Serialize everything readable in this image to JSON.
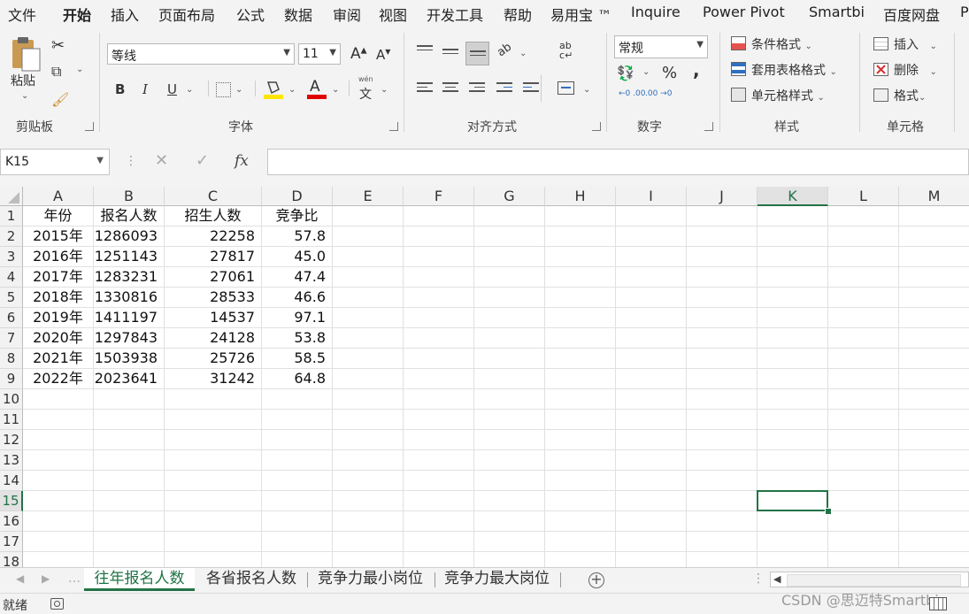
{
  "menu": [
    "文件",
    "开始",
    "插入",
    "页面布局",
    "公式",
    "数据",
    "审阅",
    "视图",
    "开发工具",
    "帮助",
    "易用宝 ™",
    "Inquire",
    "Power Pivot",
    "Smartbi",
    "百度网盘",
    "P"
  ],
  "ribbon": {
    "clipboard": {
      "paste": "粘贴",
      "group": "剪贴板"
    },
    "font": {
      "name": "等线",
      "size": "11",
      "bold": "B",
      "italic": "I",
      "underline": "U",
      "grow": "A",
      "shrink": "A",
      "color_a": "A",
      "phonetic": "文",
      "phonetic_top": "wén",
      "group": "字体"
    },
    "alignment": {
      "group": "对齐方式",
      "orient": "ab",
      "wrap_top": "ab",
      "wrap_bottom": "c"
    },
    "number": {
      "format": "常规",
      "percent": "%",
      "comma": ",",
      "inc": "←0 .00",
      "dec": ".00 →0",
      "group": "数字"
    },
    "styles": {
      "conditional": "条件格式",
      "table": "套用表格格式",
      "cell": "单元格样式",
      "group": "样式"
    },
    "cells": {
      "insert": "插入",
      "delete": "删除",
      "format": "格式",
      "group": "单元格"
    }
  },
  "formula_bar": {
    "name_box": "K15",
    "fx": "fx",
    "cancel": "✕",
    "enter": "✓",
    "content": ""
  },
  "columns": [
    "A",
    "B",
    "C",
    "D",
    "E",
    "F",
    "G",
    "H",
    "I",
    "J",
    "K",
    "L",
    "M"
  ],
  "rows": [
    "1",
    "2",
    "3",
    "4",
    "5",
    "6",
    "7",
    "8",
    "9",
    "10",
    "11",
    "12",
    "13",
    "14",
    "15",
    "16",
    "17",
    "18"
  ],
  "selected": {
    "col": "K",
    "row": "15"
  },
  "table": {
    "header": [
      "年份",
      "报名人数",
      "招生人数",
      "竞争比"
    ],
    "data": [
      [
        "2015年",
        "1286093",
        "22258",
        "57.8"
      ],
      [
        "2016年",
        "1251143",
        "27817",
        "45.0"
      ],
      [
        "2017年",
        "1283231",
        "27061",
        "47.4"
      ],
      [
        "2018年",
        "1330816",
        "28533",
        "46.6"
      ],
      [
        "2019年",
        "1411197",
        "14537",
        "97.1"
      ],
      [
        "2020年",
        "1297843",
        "24128",
        "53.8"
      ],
      [
        "2021年",
        "1503938",
        "25726",
        "58.5"
      ],
      [
        "2022年",
        "2023641",
        "31242",
        "64.8"
      ]
    ]
  },
  "sheets": [
    "往年报名人数",
    "各省报名人数",
    "竞争力最小岗位",
    "竞争力最大岗位"
  ],
  "active_sheet": 0,
  "status": {
    "ready": "就绪",
    "watermark": "CSDN @思迈特Smartbi"
  },
  "colors": {
    "accent": "#217346",
    "ribbon_bg": "#f3f3f3",
    "font_red": "#e00000",
    "highlight_yellow": "#ffe600"
  }
}
